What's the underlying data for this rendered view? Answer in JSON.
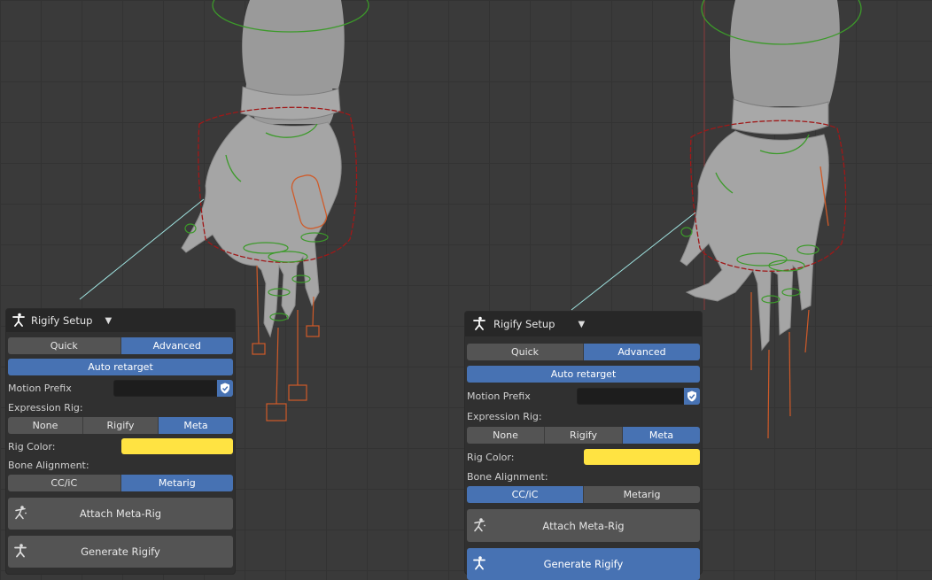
{
  "colors": {
    "accent": "#4772b3",
    "rig_color": "#ffe342",
    "panel_bg": "#303030",
    "button_bg": "#545454"
  },
  "left_panel": {
    "title": "Rigify Setup",
    "mode_tabs": [
      "Quick",
      "Advanced"
    ],
    "mode_selected": "Advanced",
    "auto_retarget_label": "Auto retarget",
    "motion_prefix_label": "Motion Prefix",
    "motion_prefix_value": "",
    "expression_rig_label": "Expression Rig:",
    "expression_options": [
      "None",
      "Rigify",
      "Meta"
    ],
    "expression_selected": "Meta",
    "rig_color_label": "Rig Color:",
    "bone_alignment_label": "Bone Alignment:",
    "alignment_options": [
      "CC/iC",
      "Metarig"
    ],
    "alignment_selected": "Metarig",
    "attach_label": "Attach Meta-Rig",
    "generate_label": "Generate Rigify"
  },
  "right_panel": {
    "title": "Rigify Setup",
    "mode_tabs": [
      "Quick",
      "Advanced"
    ],
    "mode_selected": "Advanced",
    "auto_retarget_label": "Auto retarget",
    "motion_prefix_label": "Motion Prefix",
    "motion_prefix_value": "",
    "expression_rig_label": "Expression Rig:",
    "expression_options": [
      "None",
      "Rigify",
      "Meta"
    ],
    "expression_selected": "Meta",
    "rig_color_label": "Rig Color:",
    "bone_alignment_label": "Bone Alignment:",
    "alignment_options": [
      "CC/iC",
      "Metarig"
    ],
    "alignment_selected": "CC/iC",
    "attach_label": "Attach Meta-Rig",
    "generate_label": "Generate Rigify"
  }
}
